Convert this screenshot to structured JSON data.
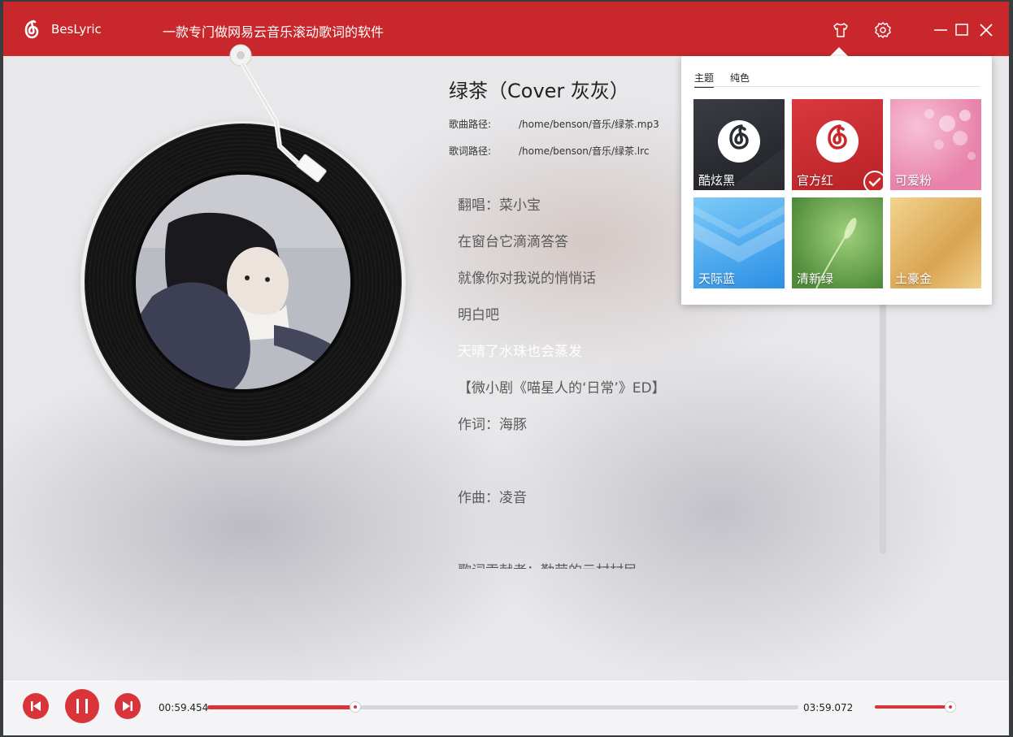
{
  "app": {
    "name": "BesLyric",
    "slogan": "一款专门做网易云音乐滚动歌词的软件",
    "accent_color": "#c8282c"
  },
  "titlebar": {
    "icons": [
      "skin-icon",
      "settings-icon",
      "minimize-icon",
      "maximize-icon",
      "close-icon"
    ]
  },
  "song": {
    "title": "绿茶（Cover 灰灰）",
    "song_path_label": "歌曲路径:",
    "song_path": "/home/benson/音乐/绿茶.mp3",
    "lyric_path_label": "歌词路径:",
    "lyric_path": "/home/benson/音乐/绿茶.lrc"
  },
  "lyrics": {
    "lines": [
      "翻唱：菜小宝",
      "在窗台它滴滴答答",
      "就像你对我说的悄悄话",
      "明白吧",
      "天晴了水珠也会蒸发",
      "【微小剧《喵星人的‘日常’》ED】",
      "作词：海豚",
      "",
      "作曲：凌音",
      "",
      "歌词贡献者：勤劳的云村村民"
    ],
    "active_index": 4
  },
  "theme_popup": {
    "tabs": [
      "主题",
      "纯色"
    ],
    "active_tab": 0,
    "themes": [
      {
        "label": "酷炫黑",
        "color": "#2a2d33"
      },
      {
        "label": "官方红",
        "color": "#c8282c",
        "selected": true
      },
      {
        "label": "可爱粉",
        "color": "#ec8fb3"
      },
      {
        "label": "天际蓝",
        "color": "#4aa8ef"
      },
      {
        "label": "清新绿",
        "color": "#6ea955"
      },
      {
        "label": "土豪金",
        "color": "#dcae5c"
      }
    ]
  },
  "player": {
    "current_time": "00:59.454",
    "total_time": "03:59.072",
    "progress": 0.25,
    "volume": 0.97,
    "controls": [
      "previous-icon",
      "pause-icon",
      "next-icon"
    ]
  }
}
